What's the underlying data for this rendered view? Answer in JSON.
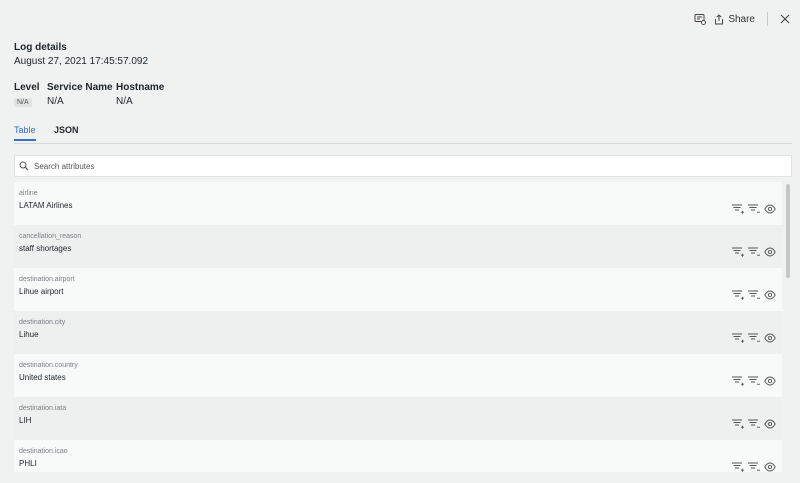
{
  "header": {
    "share_label": "Share"
  },
  "log": {
    "title": "Log details",
    "timestamp": "August 27, 2021 17:45:57.092"
  },
  "meta": {
    "level_label": "Level",
    "level_value": "N/A",
    "service_label": "Service Name",
    "service_value": "N/A",
    "host_label": "Hostname",
    "host_value": "N/A"
  },
  "tabs": {
    "table": "Table",
    "json": "JSON"
  },
  "search": {
    "placeholder": "Search attributes"
  },
  "attributes": [
    {
      "key": "airline",
      "value": "LATAM Airlines"
    },
    {
      "key": "cancellation_reason",
      "value": "staff shortages"
    },
    {
      "key": "destination.airport",
      "value": "Lihue airport"
    },
    {
      "key": "destination.city",
      "value": "Lihue"
    },
    {
      "key": "destination.country",
      "value": "United states"
    },
    {
      "key": "destination.iata",
      "value": "LIH"
    },
    {
      "key": "destination.icao",
      "value": "PHLI"
    }
  ]
}
